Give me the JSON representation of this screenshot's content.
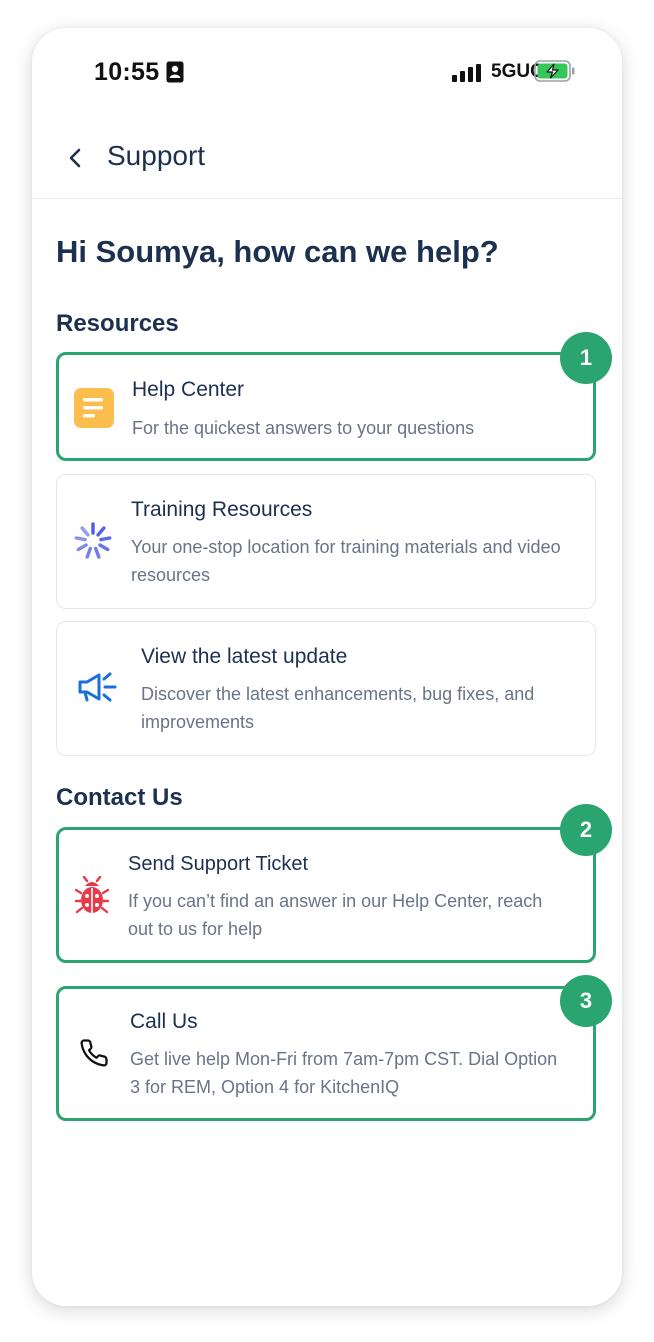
{
  "status_bar": {
    "time": "10:55",
    "network": "5GUC",
    "icons": [
      "id-badge-icon",
      "signal-icon",
      "battery-charging-icon"
    ]
  },
  "header": {
    "back_icon": "chevron-left-icon",
    "title": "Support"
  },
  "greeting": "Hi Soumya, how can we help?",
  "resources": {
    "title": "Resources",
    "items": [
      {
        "icon": "document-icon",
        "title": "Help Center",
        "description": "For the quickest answers to your questions",
        "highlighted": true,
        "badge": "1"
      },
      {
        "icon": "spinner-burst-icon",
        "title": "Training Resources",
        "description": "Your one-stop location for training materials and video resources",
        "highlighted": false
      },
      {
        "icon": "megaphone-icon",
        "title": "View the latest update",
        "description": "Discover the latest enhancements, bug fixes, and improvements",
        "highlighted": false
      }
    ]
  },
  "contact": {
    "title": "Contact Us",
    "items": [
      {
        "icon": "bug-icon",
        "title": "Send Support Ticket",
        "description": "If you can’t find an answer in our Help Center, reach out to us for help",
        "highlighted": true,
        "badge": "2"
      },
      {
        "icon": "phone-icon",
        "title": "Call Us",
        "description": "Get live help Mon-Fri from 7am-7pm CST. Dial Option 3 for REM, Option 4 for KitchenIQ",
        "highlighted": true,
        "badge": "3"
      }
    ]
  },
  "colors": {
    "highlight_green": "#2ba570",
    "title_navy": "#1c3050",
    "description_gray": "#697487",
    "help_center_yellow": "#fbbd4c",
    "training_blue": "#4a5ce0",
    "megaphone_blue": "#1a6fdc",
    "bug_red": "#e8394b",
    "battery_green": "#35c759"
  }
}
